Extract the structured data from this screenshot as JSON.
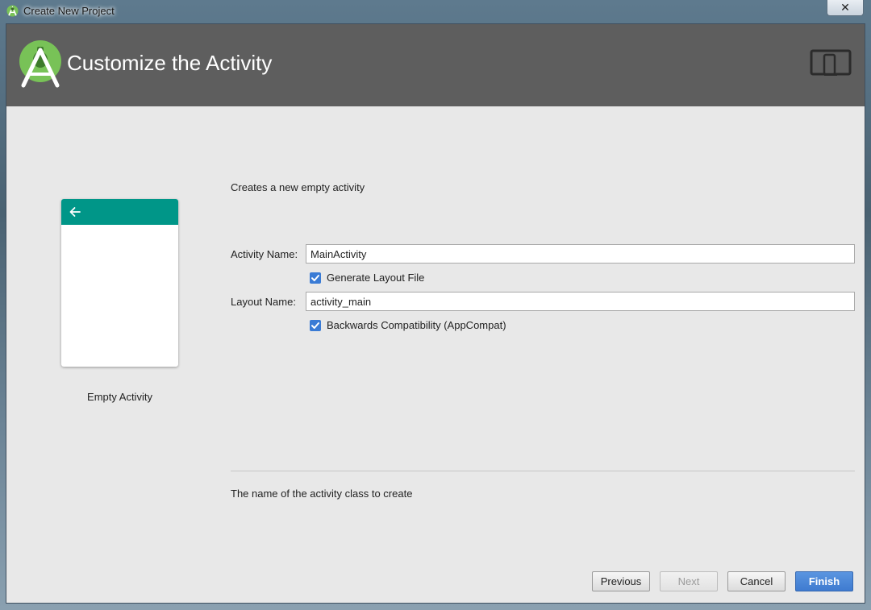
{
  "window": {
    "title": "Create New Project",
    "close_label": "✕"
  },
  "header": {
    "title": "Customize the Activity"
  },
  "preview": {
    "caption": "Empty Activity",
    "appbar_color": "#009688"
  },
  "form": {
    "description": "Creates a new empty activity",
    "activity_name_label": "Activity Name:",
    "activity_name_value": "MainActivity",
    "generate_layout_label": "Generate Layout File",
    "generate_layout_checked": true,
    "layout_name_label": "Layout Name:",
    "layout_name_value": "activity_main",
    "backwards_compat_label": "Backwards Compatibility (AppCompat)",
    "backwards_compat_checked": true
  },
  "help": {
    "text": "The name of the activity class to create"
  },
  "buttons": {
    "previous": "Previous",
    "next": "Next",
    "cancel": "Cancel",
    "finish": "Finish"
  },
  "colors": {
    "header_bg": "#5e5e5e",
    "body_bg": "#e8e8e8",
    "accent": "#3a7bd5",
    "android_green": "#78c257"
  },
  "icons": {
    "title": "android-studio-icon",
    "logo": "android-studio-logo",
    "device": "device-form-factor-icon",
    "back": "arrow-back-icon",
    "check": "check-icon"
  }
}
